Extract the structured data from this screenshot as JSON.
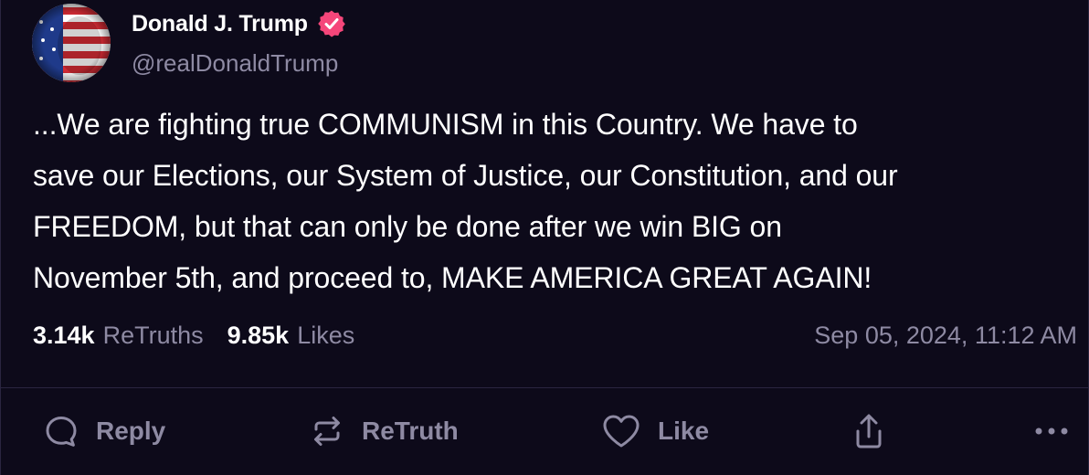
{
  "author": {
    "display_name": "Donald J. Trump",
    "handle": "@realDonaldTrump",
    "verified": true,
    "verified_color": "#f5467a"
  },
  "post": {
    "lines": [
      "...We are fighting true COMMUNISM in this Country. We have to",
      "save our Elections, our System of Justice, our Constitution, and our",
      "FREEDOM, but that can only be done after we win BIG on",
      "November 5th, and proceed to, MAKE AMERICA GREAT AGAIN!"
    ]
  },
  "stats": {
    "retruths_count": "3.14k",
    "retruths_label": "ReTruths",
    "likes_count": "9.85k",
    "likes_label": "Likes",
    "timestamp": "Sep 05, 2024, 11:12 AM"
  },
  "actions": {
    "reply": {
      "label": "Reply",
      "icon": "reply-icon"
    },
    "retruth": {
      "label": "ReTruth",
      "icon": "retruth-icon"
    },
    "like": {
      "label": "Like",
      "icon": "heart-icon"
    },
    "share": {
      "icon": "share-icon"
    },
    "more": {
      "icon": "more-icon"
    }
  },
  "colors": {
    "background": "#0d0a1a",
    "muted_text": "#8e8aa3",
    "divider": "#2a2540"
  }
}
